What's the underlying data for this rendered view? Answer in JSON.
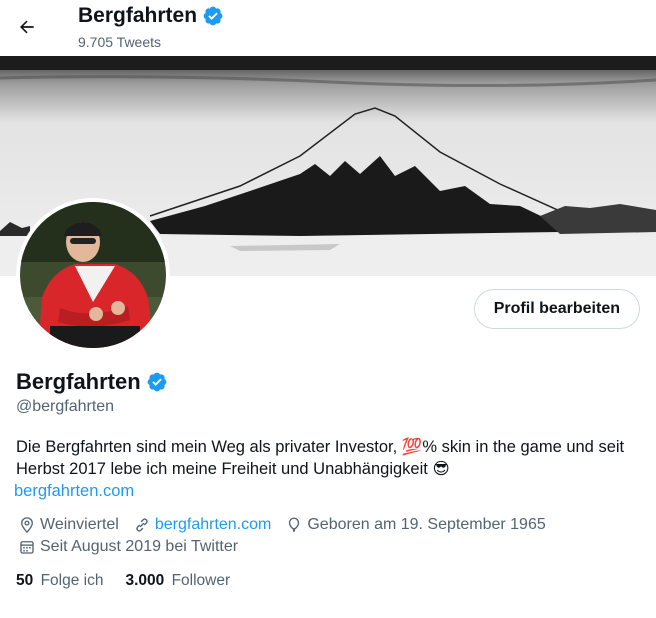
{
  "header": {
    "display_name": "Bergfahrten",
    "tweet_count": "9.705 Tweets"
  },
  "profile": {
    "display_name": "Bergfahrten",
    "handle": "@bergfahrten",
    "verified_icon": "verified-badge-icon",
    "edit_button": "Profil bearbeiten",
    "bio_before": "Die Bergfahrten sind mein Weg als privater Investor, ",
    "bio_emoji_hundred": "💯",
    "bio_after": "% skin in the game und seit Herbst 2017 lebe ich meine Freiheit und Unabhängigkeit ",
    "bio_emoji_sunglasses": "😎",
    "bio_link": "bergfahrten.com",
    "location": "Weinviertel",
    "website": "bergfahrten.com",
    "birthday": "Geboren am 19. September 1965",
    "joined": "Seit August 2019 bei Twitter",
    "following_count": "50",
    "following_label": "Folge ich",
    "followers_count": "3.000",
    "followers_label": "Follower"
  },
  "colors": {
    "accent": "#1d9bf0",
    "text_primary": "#0f1419",
    "text_secondary": "#536471"
  },
  "icons": [
    "back-arrow-icon",
    "verified-badge-icon",
    "location-pin-icon",
    "link-icon",
    "balloon-icon",
    "calendar-icon"
  ]
}
